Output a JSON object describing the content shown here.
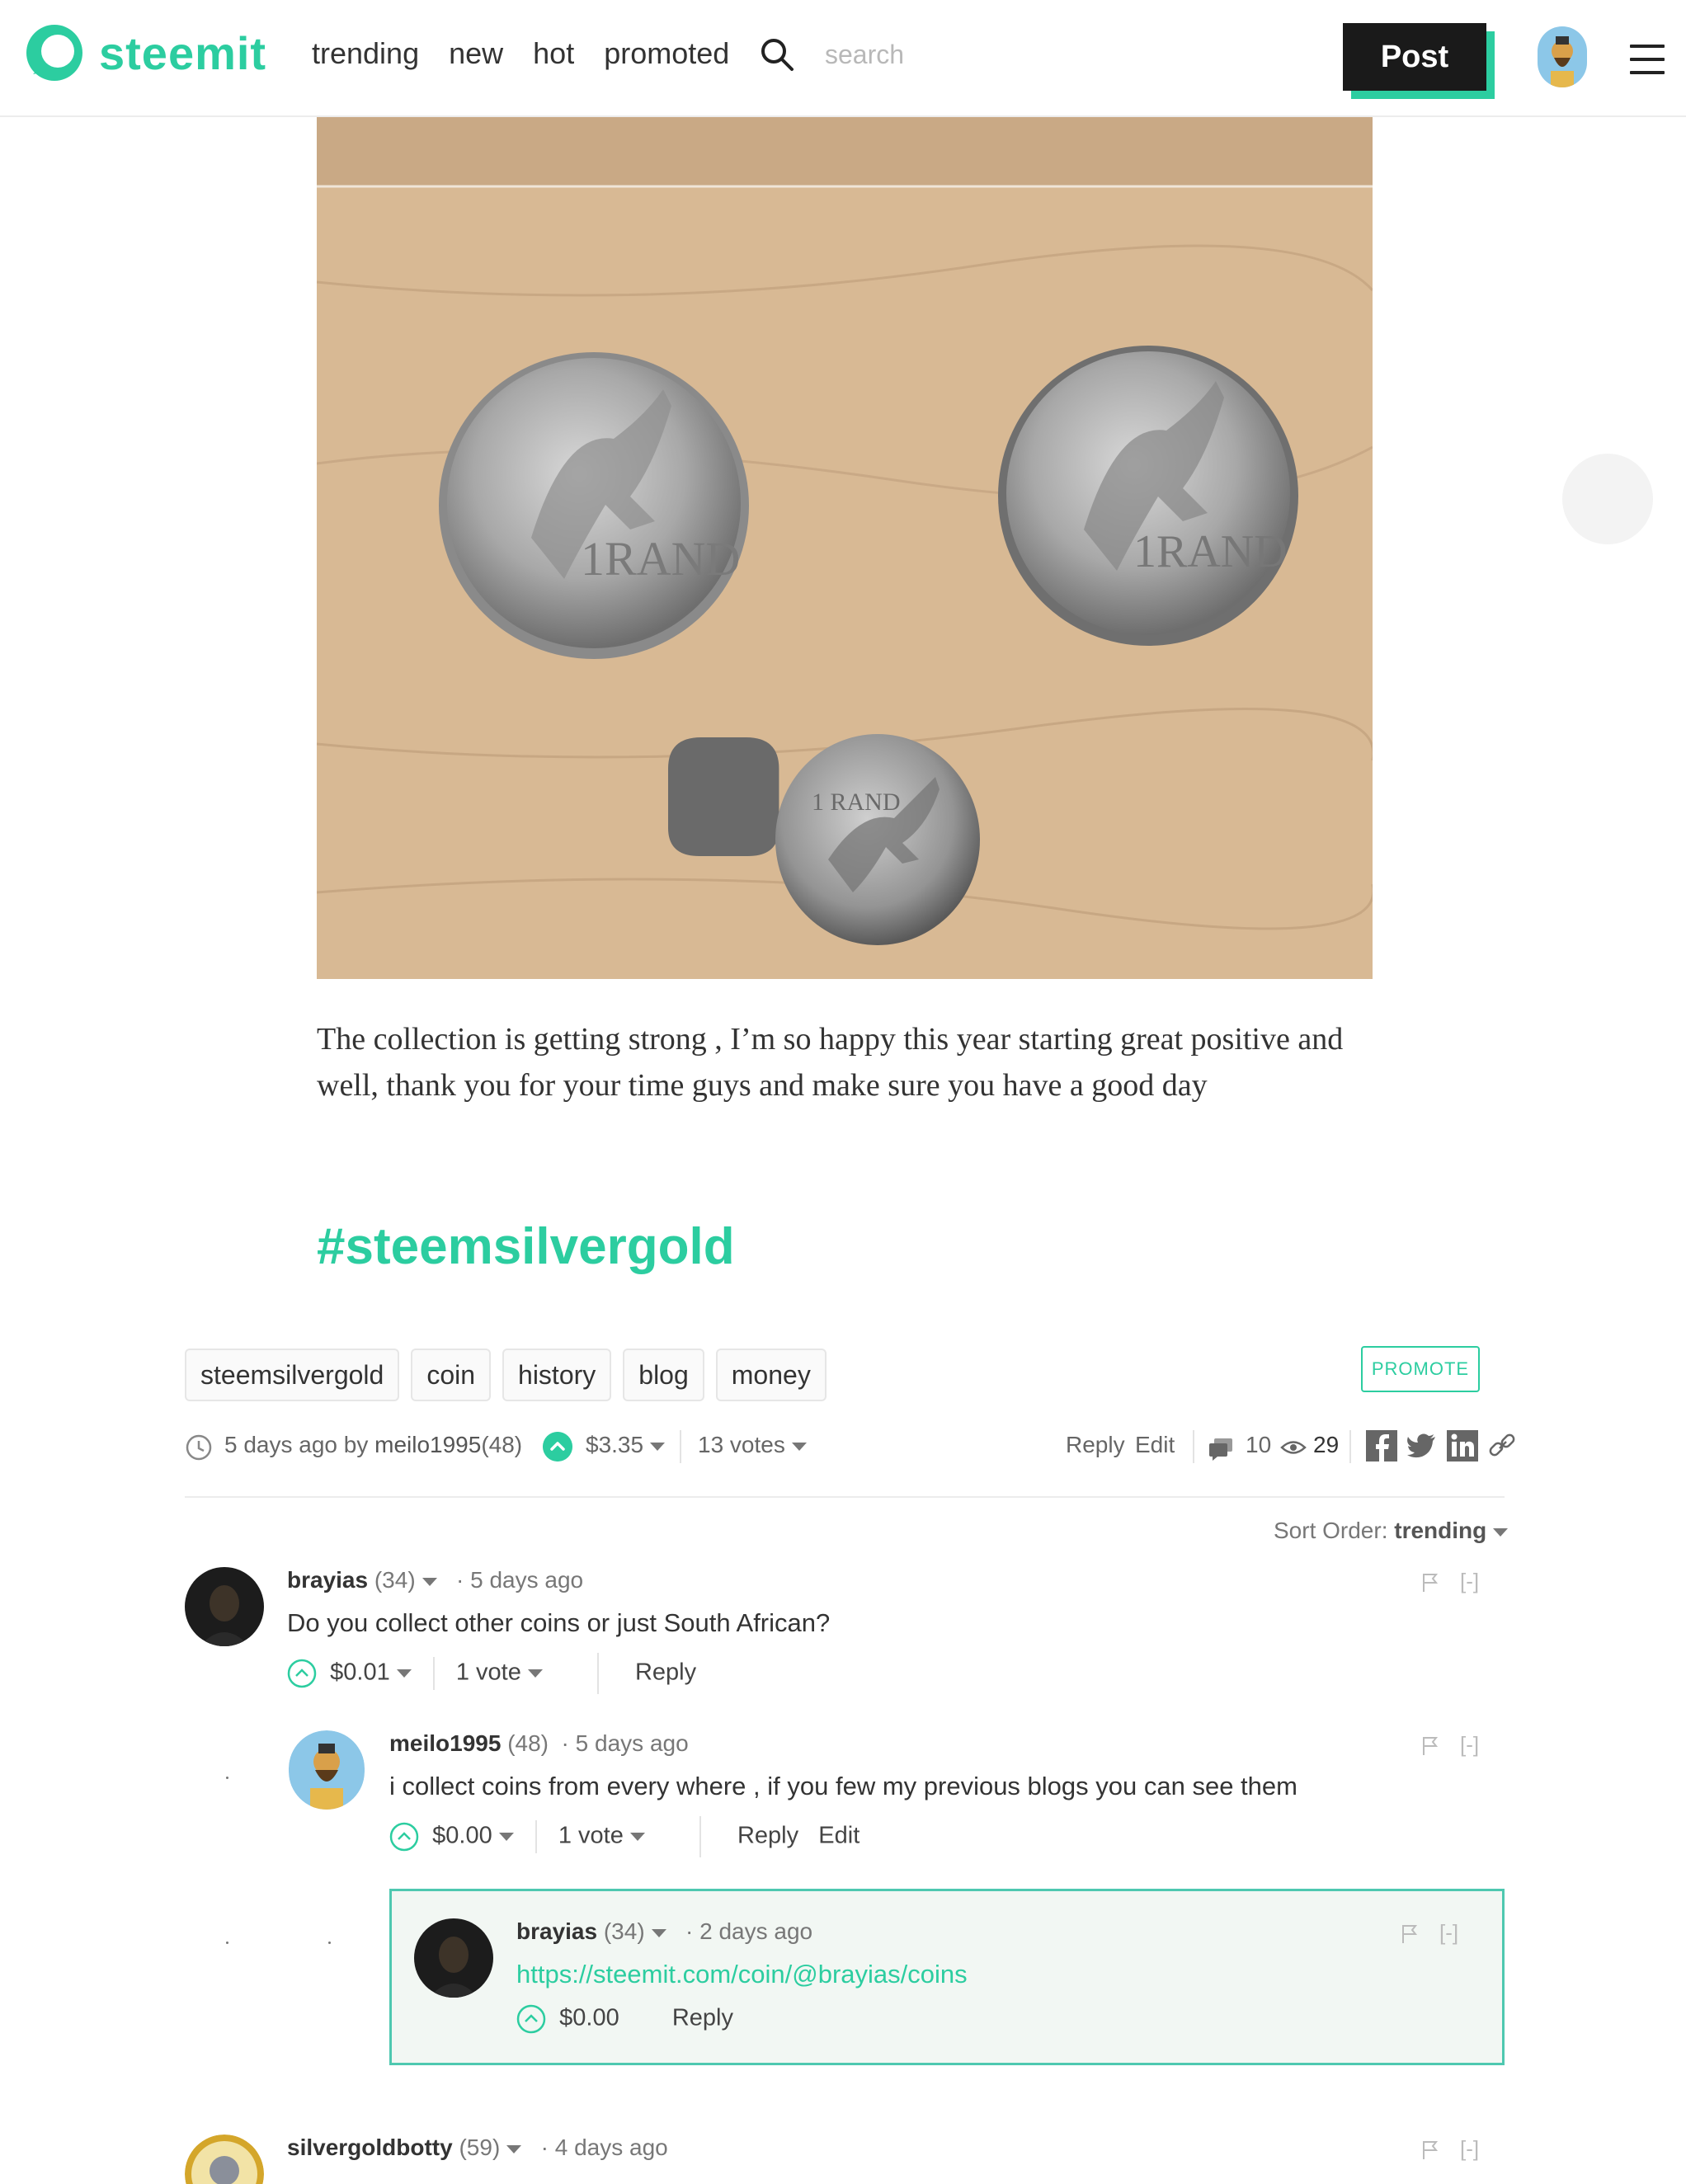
{
  "header": {
    "logo_text": "steemit",
    "nav": [
      "trending",
      "new",
      "hot",
      "promoted"
    ],
    "search_placeholder": "search",
    "post_label": "Post",
    "accent": "#2ccda0"
  },
  "post": {
    "image_alt": "",
    "body": "The collection is getting strong , I’m so happy this year starting great positive and well, thank you for your time guys and make sure you have a good day",
    "hashtag": "#steemsilvergold",
    "tags": [
      "steemsilvergold",
      "coin",
      "history",
      "blog",
      "money"
    ],
    "promote_label": "PROMOTE",
    "meta": {
      "when": "5 days ago by",
      "author": "meilo1995",
      "reputation": "(48)",
      "payout": "$3.35",
      "votes": "13 votes",
      "reply": "Reply",
      "edit": "Edit",
      "comments": "10",
      "views": "29"
    }
  },
  "sort": {
    "label": "Sort Order:",
    "value": "trending"
  },
  "comments": [
    {
      "author": "brayias",
      "reputation": "(34)",
      "time": "5 days ago",
      "body": "Do you collect other coins or just South African?",
      "payout": "$0.01",
      "votes": "1 vote",
      "reply": "Reply",
      "collapse": "[-]"
    },
    {
      "author": "meilo1995",
      "reputation": "(48)",
      "time": "5 days ago",
      "body": "i collect coins from every where , if you few my previous blogs you can see them",
      "payout": "$0.00",
      "votes": "1 vote",
      "reply": "Reply",
      "edit": "Edit",
      "collapse": "[-]"
    },
    {
      "author": "brayias",
      "reputation": "(34)",
      "time": "2 days ago",
      "body": "https://steemit.com/coin/@brayias/coins",
      "payout": "$0.00",
      "reply": "Reply",
      "collapse": "[-]"
    },
    {
      "author": "silvergoldbotty",
      "reputation": "(59)",
      "time": "4 days ago",
      "collapse": "[-]"
    }
  ]
}
